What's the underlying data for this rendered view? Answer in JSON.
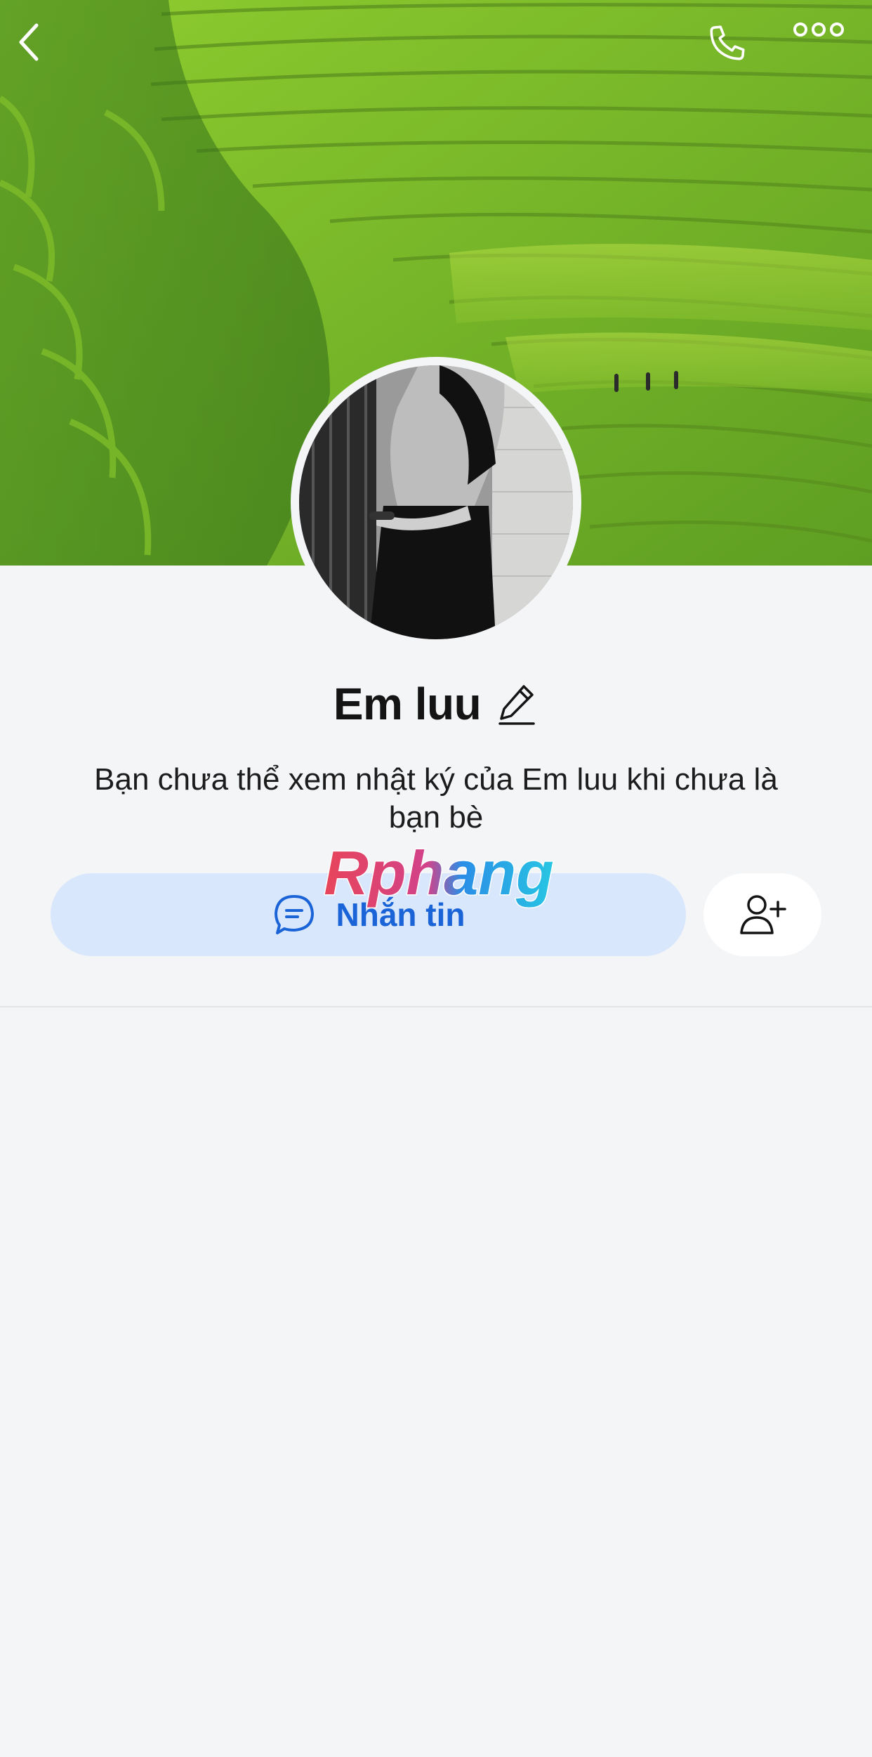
{
  "profile": {
    "name": "Em luu",
    "notice": "Bạn chưa thể xem nhật ký của Em luu khi chưa là bạn bè"
  },
  "actions": {
    "message_label": "Nhắn tin"
  },
  "watermark": {
    "text": "Rphang"
  },
  "icons": {
    "back": "chevron-left-icon",
    "call": "phone-icon",
    "more": "more-dots-icon",
    "edit": "pencil-icon",
    "message": "chat-bubble-icon",
    "add_friend": "add-user-icon"
  },
  "colors": {
    "accent": "#1b64d8",
    "message_button_bg": "#d9e7fd",
    "background": "#f4f5f7"
  }
}
